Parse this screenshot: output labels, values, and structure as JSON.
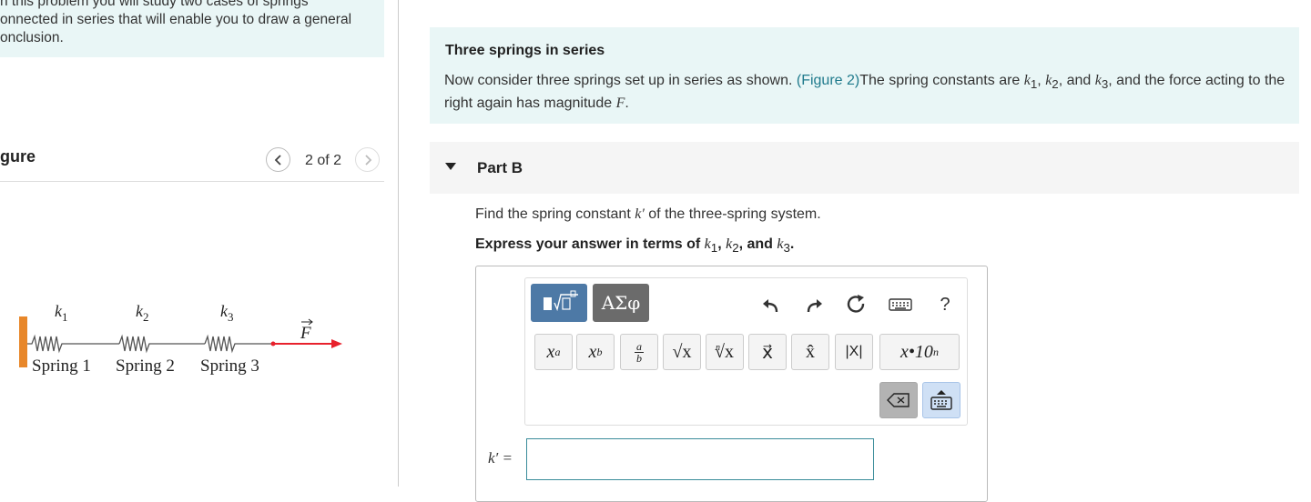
{
  "intro": {
    "text": "n this problem you will study two cases of springs\nonnected in series that will enable you to draw a general\nonclusion."
  },
  "figure": {
    "title": "gure",
    "page_count": "2 of 2",
    "labels": {
      "k1": "k",
      "k1_sub": "1",
      "k2": "k",
      "k2_sub": "2",
      "k3": "k",
      "k3_sub": "3",
      "force": "F"
    },
    "springs": [
      "Spring 1",
      "Spring 2",
      "Spring 3"
    ],
    "colors": {
      "wall": "#e8872a",
      "force": "#e8212c",
      "spring": "#555555"
    }
  },
  "description": {
    "title": "Three springs in series",
    "text_before": "Now consider three springs set up in series as shown. ",
    "link": "(Figure 2)",
    "text_mid": "The spring constants are ",
    "k1": "k",
    "k1_sub": "1",
    "sep1": ", ",
    "k2": "k",
    "k2_sub": "2",
    "sep2": ", and ",
    "k3": "k",
    "k3_sub": "3",
    "text_after": ", and the force acting to the right again has magnitude ",
    "F": "F",
    "end": "."
  },
  "partB": {
    "title": "Part B",
    "question_before": "Find the spring constant ",
    "question_var": "k′",
    "question_after": " of the three-spring system.",
    "instruction_before": "Express your answer in terms of ",
    "instr_k1": "k",
    "instr_k1_sub": "1",
    "instr_sep1": ", ",
    "instr_k2": "k",
    "instr_k2_sub": "2",
    "instr_sep2": ", and ",
    "instr_k3": "k",
    "instr_k3_sub": "3",
    "instruction_end": ".",
    "answer_label": "k′ =",
    "answer_value": ""
  },
  "toolbar": {
    "greek_label": "ΑΣφ",
    "help_label": "?",
    "buttons": [
      {
        "name": "superscript-button",
        "base": "x",
        "mod": "a",
        "kind": "sup"
      },
      {
        "name": "subscript-button",
        "base": "x",
        "mod": "b",
        "kind": "sub"
      },
      {
        "name": "fraction-button",
        "base": "a",
        "mod": "b",
        "kind": "frac"
      },
      {
        "name": "sqrt-button",
        "base": "√x",
        "mod": "",
        "kind": "text"
      },
      {
        "name": "nth-root-button",
        "base": "√x",
        "mod": "n",
        "kind": "root"
      },
      {
        "name": "vector-button",
        "base": "x⃗",
        "mod": "",
        "kind": "text"
      },
      {
        "name": "unit-vector-button",
        "base": "x̂",
        "mod": "",
        "kind": "text"
      },
      {
        "name": "abs-button",
        "base": "|X|",
        "mod": "",
        "kind": "abs"
      },
      {
        "name": "sci-notation-button",
        "base": "x•10",
        "mod": "n",
        "kind": "sup"
      }
    ]
  },
  "colors": {
    "accent": "#4d79a6",
    "info_bg": "#e9f6f6",
    "link": "#1f7a8c"
  }
}
